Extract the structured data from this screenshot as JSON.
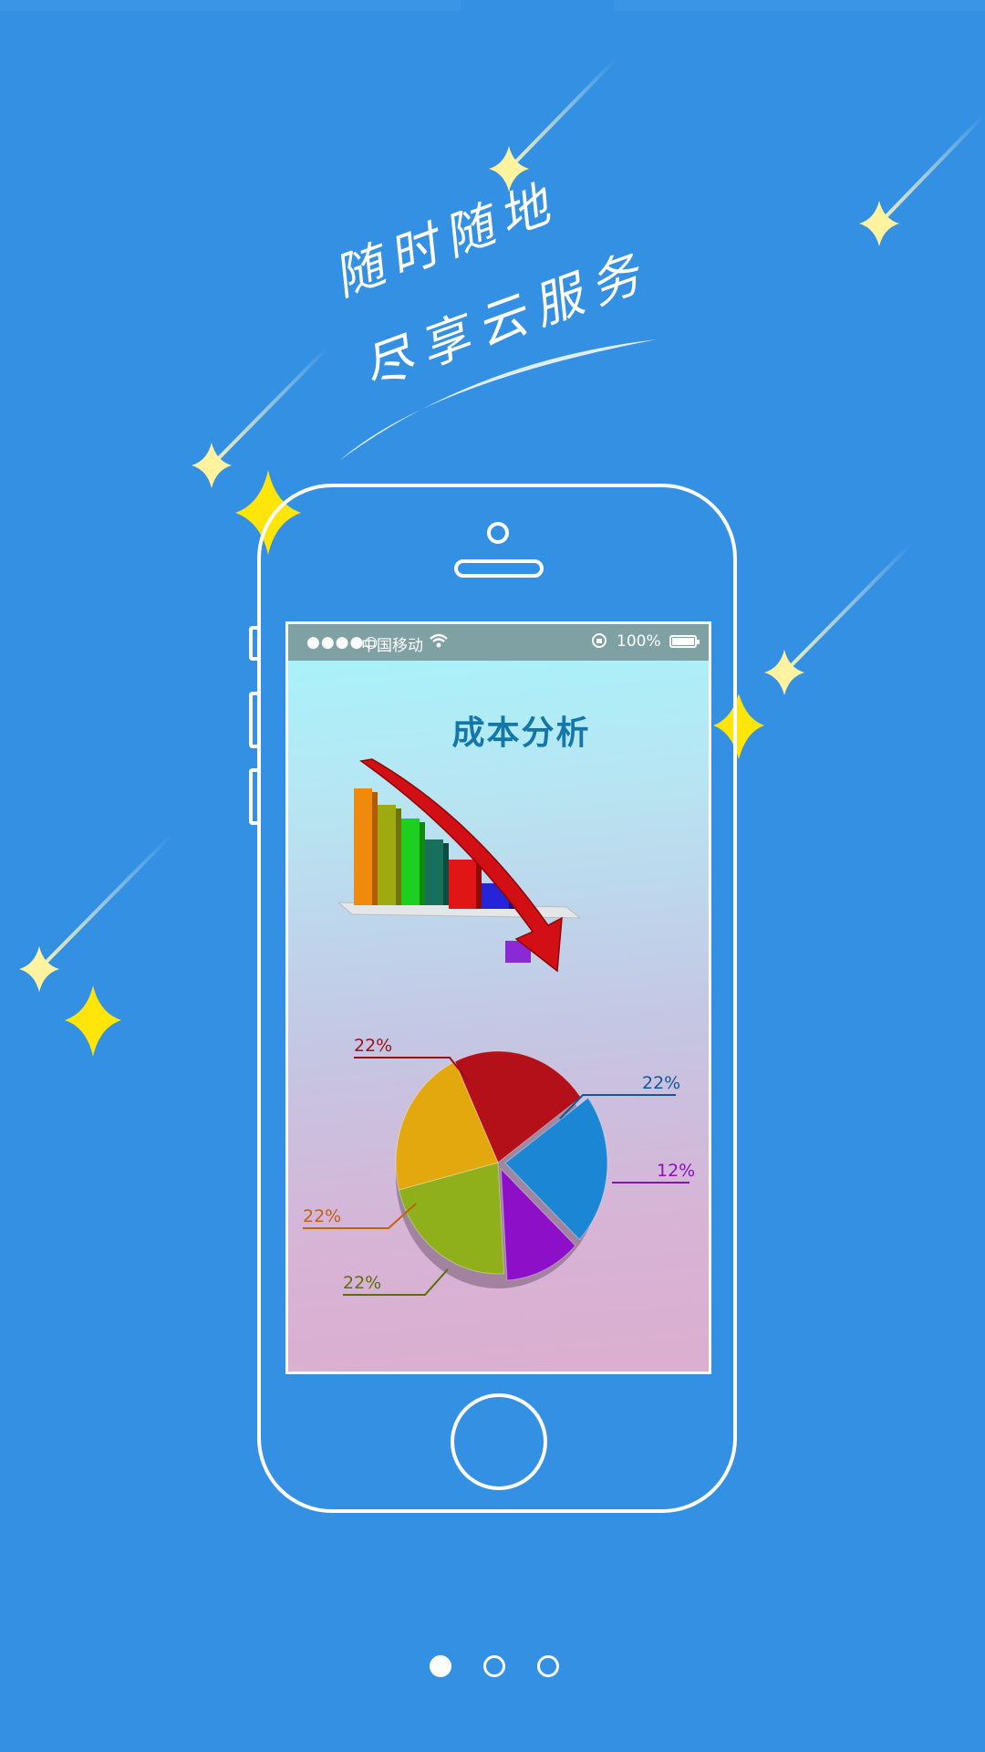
{
  "slogan": {
    "line1": "随时随地",
    "line2": "尽享云服务"
  },
  "phone": {
    "status_bar": {
      "signal": "●●●●○",
      "carrier": "中国移动",
      "wifi_icon": "wifi-icon",
      "battery_pct": "100%"
    },
    "screen_title": "成本分析",
    "chart_data": {
      "type": "pie",
      "slices": [
        {
          "label": "22%",
          "value": 22,
          "color": "#b3101a"
        },
        {
          "label": "22%",
          "value": 22,
          "color": "#1a86d4"
        },
        {
          "label": "12%",
          "value": 12,
          "color": "#8e0fc8"
        },
        {
          "label": "22%",
          "value": 22,
          "color": "#8fb01a"
        },
        {
          "label": "22%",
          "value": 22,
          "color": "#e2a80e"
        }
      ]
    }
  },
  "pager": {
    "count": 3,
    "active_index": 0
  },
  "colors": {
    "background": "#3390e2",
    "star": "#ffe74d",
    "star_pale": "#fff3a0"
  }
}
